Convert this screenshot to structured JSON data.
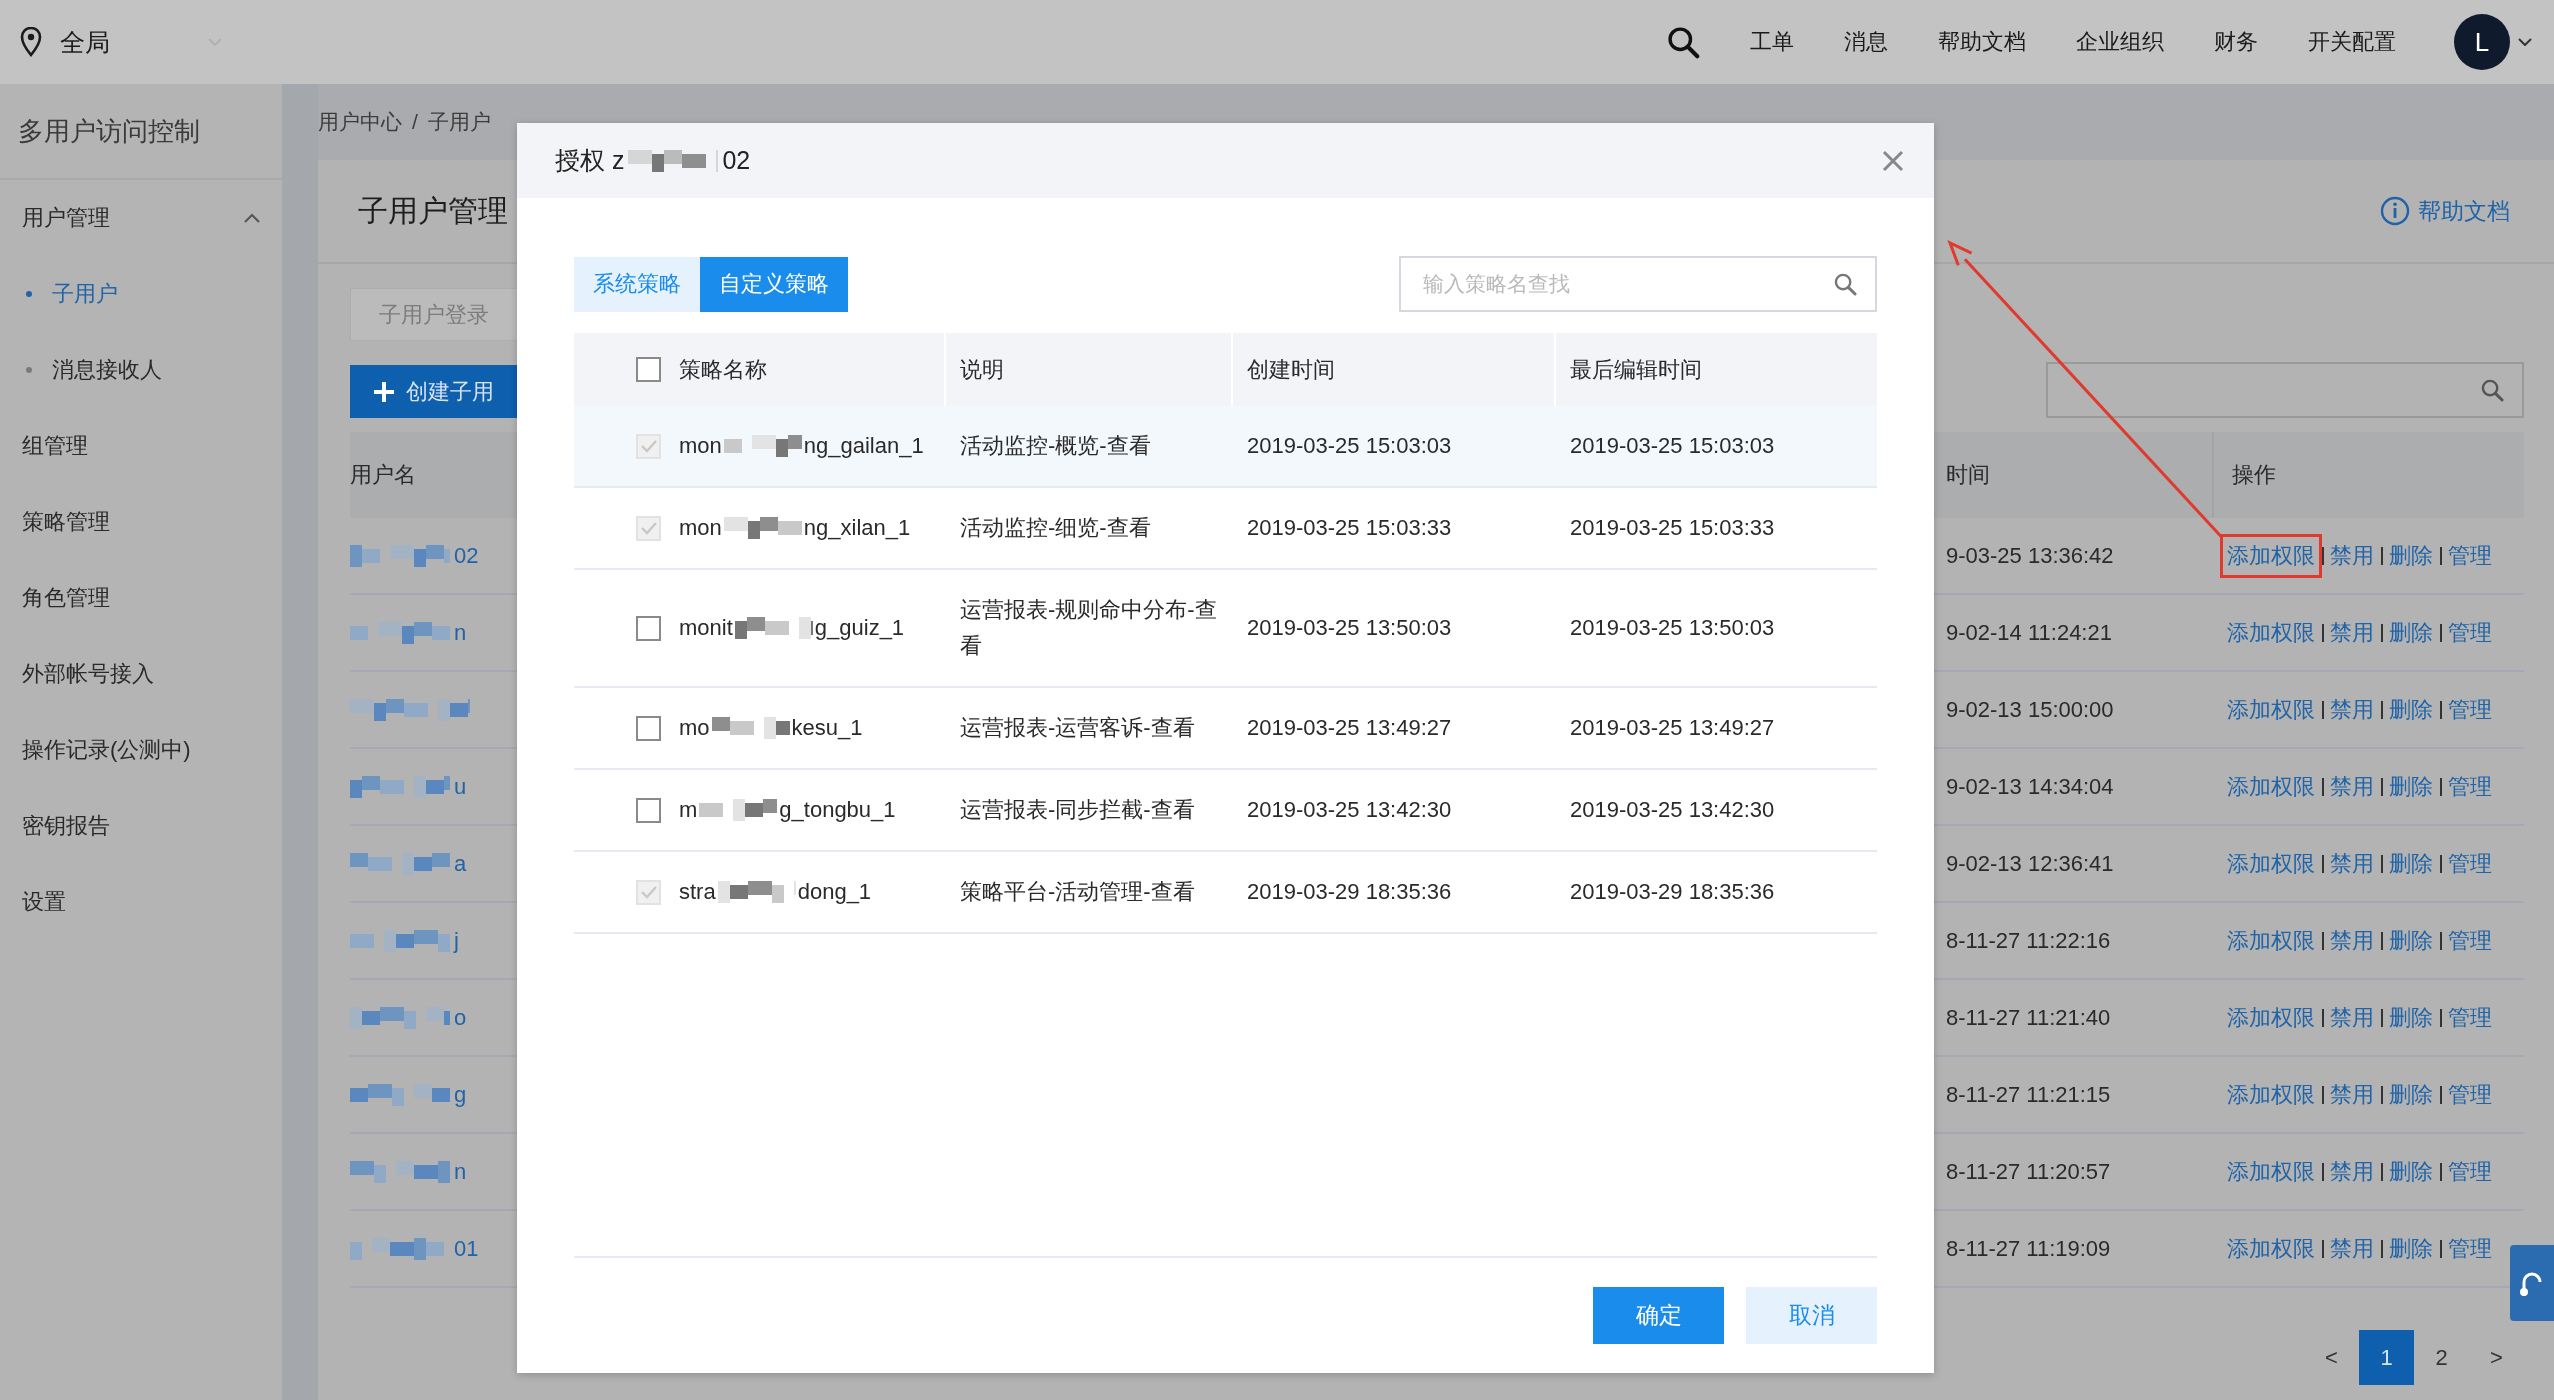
{
  "top_bar": {
    "scope_label": "全局",
    "nav": [
      "工单",
      "消息",
      "帮助文档",
      "企业组织",
      "财务",
      "开关配置"
    ],
    "avatar": "L"
  },
  "sidebar": {
    "title": "多用户访问控制",
    "items": [
      {
        "kind": "group",
        "label": "用户管理",
        "expanded": true,
        "children": [
          {
            "label": "子用户",
            "selected": true
          },
          {
            "label": "消息接收人",
            "selected": false
          }
        ]
      },
      {
        "kind": "link",
        "label": "组管理",
        "selected": false
      },
      {
        "kind": "link",
        "label": "策略管理",
        "selected": false
      },
      {
        "kind": "link",
        "label": "角色管理",
        "selected": false
      },
      {
        "kind": "link",
        "label": "外部帐号接入",
        "selected": false
      },
      {
        "kind": "link",
        "label": "操作记录(公测中)",
        "selected": false
      },
      {
        "kind": "link",
        "label": "密钥报告",
        "selected": false
      },
      {
        "kind": "link",
        "label": "设置",
        "selected": false
      }
    ]
  },
  "breadcrumb": {
    "items": [
      "用户中心",
      "子用户"
    ],
    "separator": "/"
  },
  "page": {
    "title": "子用户管理",
    "help_link": "帮助文档",
    "login_link_label": "子用户登录",
    "create_button": "创建子用",
    "columns": [
      "用户名",
      "时间",
      "操作"
    ],
    "rows": [
      {
        "name_tail": "02",
        "time": "9-03-25 13:36:42",
        "actions": [
          "添加权限",
          "禁用",
          "删除",
          "管理"
        ],
        "annotated": true
      },
      {
        "name_tail": "n",
        "time": "9-02-14 11:24:21",
        "actions": [
          "添加权限",
          "禁用",
          "删除",
          "管理"
        ],
        "annotated": false
      },
      {
        "time": "9-02-13 15:00:00",
        "actions": [
          "添加权限",
          "禁用",
          "删除",
          "管理"
        ],
        "annotated": false
      },
      {
        "name_tail": "u",
        "time": "9-02-13 14:34:04",
        "actions": [
          "添加权限",
          "禁用",
          "删除",
          "管理"
        ],
        "annotated": false
      },
      {
        "name_tail": "a",
        "time": "9-02-13 12:36:41",
        "actions": [
          "添加权限",
          "禁用",
          "删除",
          "管理"
        ],
        "annotated": false
      },
      {
        "name_tail": "j",
        "time": "8-11-27 11:22:16",
        "actions": [
          "添加权限",
          "禁用",
          "删除",
          "管理"
        ],
        "annotated": false
      },
      {
        "name_tail": "o",
        "time": "8-11-27 11:21:40",
        "actions": [
          "添加权限",
          "禁用",
          "删除",
          "管理"
        ],
        "annotated": false
      },
      {
        "name_tail": "g",
        "time": "8-11-27 11:21:15",
        "actions": [
          "添加权限",
          "禁用",
          "删除",
          "管理"
        ],
        "annotated": false
      },
      {
        "name_tail": "n",
        "time": "8-11-27 11:20:57",
        "actions": [
          "添加权限",
          "禁用",
          "删除",
          "管理"
        ],
        "annotated": false
      },
      {
        "name_tail": "01",
        "time": "8-11-27 11:19:09",
        "actions": [
          "添加权限",
          "禁用",
          "删除",
          "管理"
        ],
        "annotated": false
      }
    ],
    "pagination": [
      {
        "label": "<",
        "selected": false
      },
      {
        "label": "1",
        "selected": true
      },
      {
        "label": "2",
        "selected": false
      },
      {
        "label": ">",
        "selected": false
      }
    ]
  },
  "modal": {
    "title_start": "授权 z",
    "title_end": "02",
    "tabs": [
      {
        "label": "系统策略",
        "selected": false
      },
      {
        "label": "自定义策略",
        "selected": true
      }
    ],
    "search": {
      "placeholder": "输入策略名查找"
    },
    "select_all": false,
    "columns": [
      "策略名称",
      "说明",
      "创建时间",
      "最后编辑时间"
    ],
    "rows": [
      {
        "name_start": "mon",
        "name_end": "ng_gailan_1",
        "description": "活动监控-概览-查看",
        "created": "2019-03-25 15:03:03",
        "edited": "2019-03-25 15:03:03",
        "checked": true,
        "disabled": true,
        "hovered": true
      },
      {
        "name_start": "mon",
        "name_end": "ng_xilan_1",
        "description": "活动监控-细览-查看",
        "created": "2019-03-25 15:03:33",
        "edited": "2019-03-25 15:03:33",
        "checked": true,
        "disabled": true,
        "hovered": false
      },
      {
        "name_start": "monit",
        "name_end": "g_guiz_1",
        "description": "运营报表-规则命中分布-查看",
        "created": "2019-03-25 13:50:03",
        "edited": "2019-03-25 13:50:03",
        "checked": false,
        "disabled": false,
        "hovered": false
      },
      {
        "name_start": "mo",
        "name_end": "kesu_1",
        "description": "运营报表-运营客诉-查看",
        "created": "2019-03-25 13:49:27",
        "edited": "2019-03-25 13:49:27",
        "checked": false,
        "disabled": false,
        "hovered": false
      },
      {
        "name_start": "m",
        "name_end": "g_tongbu_1",
        "description": "运营报表-同步拦截-查看",
        "created": "2019-03-25 13:42:30",
        "edited": "2019-03-25 13:42:30",
        "checked": false,
        "disabled": false,
        "hovered": false
      },
      {
        "name_start": "stra",
        "name_end": "dong_1",
        "description": "策略平台-活动管理-查看",
        "created": "2019-03-29 18:35:36",
        "edited": "2019-03-29 18:35:36",
        "checked": true,
        "disabled": true,
        "hovered": false
      }
    ],
    "buttons": [
      {
        "kind": "primary",
        "label": "确定"
      },
      {
        "kind": "secondary",
        "label": "取消"
      }
    ]
  }
}
